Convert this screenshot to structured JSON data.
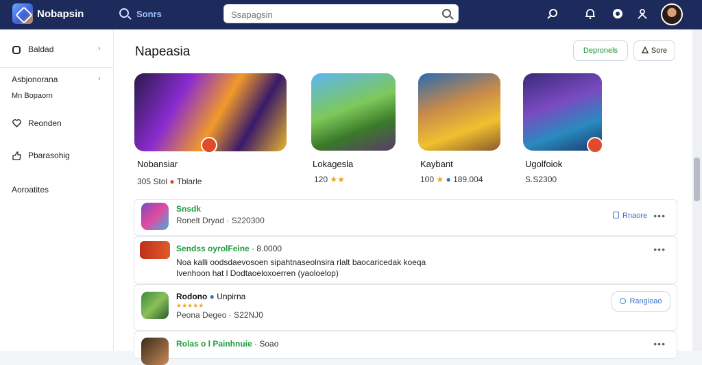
{
  "header": {
    "brand": "Nobapsin",
    "nav_link": "Sonrs",
    "search_placeholder": "Ssapagsin",
    "icons": [
      "dice-icon",
      "bell-icon",
      "chat-icon",
      "person-icon"
    ]
  },
  "sidebar": {
    "items": [
      {
        "label": "Baldad",
        "icon": "circle-icon",
        "chevron": "›"
      },
      {
        "label": "Asbjonorana",
        "chevron": "›"
      },
      {
        "label": "Mn Bopaorn"
      },
      {
        "label": "Reonden",
        "icon": "heart-icon"
      },
      {
        "label": "Pbarasohig",
        "icon": "thumb-icon"
      },
      {
        "label": "Aoroatites"
      }
    ]
  },
  "main": {
    "title": "Napeasia",
    "btn_primary": "Depronels",
    "btn_secondary": "Sore",
    "cards": [
      {
        "name": "Nobansiar",
        "meta1": "305 Stol",
        "meta2": "Tblarle"
      },
      {
        "name": "Lokagesla",
        "meta1": "120",
        "meta2": ""
      },
      {
        "name": "Kaybant",
        "meta1": "100",
        "meta2": "189.004"
      },
      {
        "name": "Ugolfoiok",
        "meta1": "S.S2300",
        "meta2": ""
      }
    ],
    "list": [
      {
        "title": "Snsdk",
        "sub": "Ronelt Dryad · S220300",
        "action": "Rnaore"
      },
      {
        "title": "Sendss oyrolFeine",
        "title2": "· 8.0000",
        "body1": "Noa kalli oodsdaevosoen sipahtnaseolnsira rlalt baocaricedak koeqa",
        "body2": "Ivenhoon hat l Dodtaoeloxoerren (yaoloelop)"
      },
      {
        "title": "Rodono",
        "title2": "Unpirna",
        "sub": "Peona Degeo · S22NJ0",
        "action": "Rangioao"
      },
      {
        "title": "Rolas o l Painhnuie",
        "title2": "· Soao"
      }
    ]
  },
  "colors": {
    "topbar": "#1d2a5c",
    "accent_green": "#1a9d3b",
    "badge_red": "#e24a2c"
  }
}
